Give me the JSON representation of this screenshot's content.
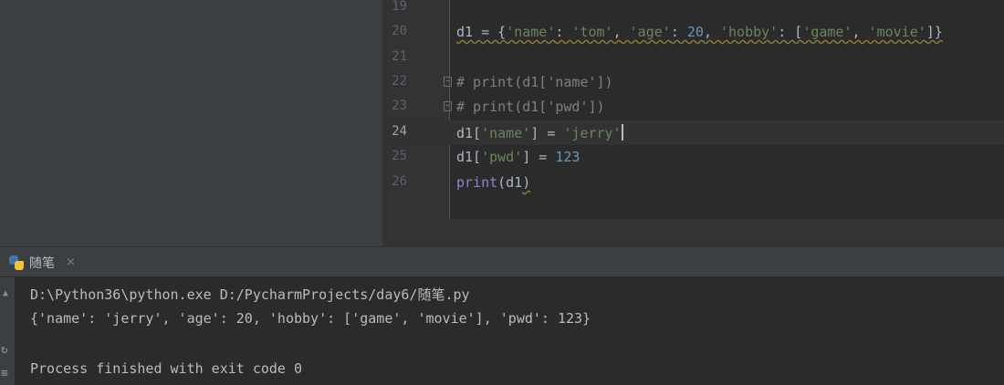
{
  "editor": {
    "lines": [
      {
        "num": "19"
      },
      {
        "num": "20"
      },
      {
        "num": "21"
      },
      {
        "num": "22"
      },
      {
        "num": "23"
      },
      {
        "num": "24"
      },
      {
        "num": "25"
      },
      {
        "num": "26"
      }
    ],
    "tokens": {
      "l20": [
        "d1 = {",
        "'name'",
        ": ",
        "'tom'",
        ", ",
        "'age'",
        ": ",
        "20",
        ", ",
        "'hobby'",
        ": [",
        "'game'",
        ", ",
        "'movie'",
        "]}"
      ],
      "l22": "# print(d1['name'])",
      "l23": "# print(d1['pwd'])",
      "l24": [
        "d1[",
        "'name'",
        "] = ",
        "'jerry'"
      ],
      "l25": [
        "d1[",
        "'pwd'",
        "] = ",
        "123"
      ],
      "l26": [
        "print",
        "(d1",
        ")"
      ]
    }
  },
  "run_panel": {
    "tab_label": "随笔",
    "tab_close": "×",
    "output": [
      "D:\\Python36\\python.exe D:/PycharmProjects/day6/随笔.py",
      "{'name': 'jerry', 'age': 20, 'hobby': ['game', 'movie'], 'pwd': 123}",
      "",
      "Process finished with exit code 0"
    ]
  },
  "icons": {
    "tab_icon": "python-icon",
    "scroll_up": "arrow-up-icon",
    "rerun": "rerun-icon",
    "wrap": "soft-wrap-icon"
  }
}
